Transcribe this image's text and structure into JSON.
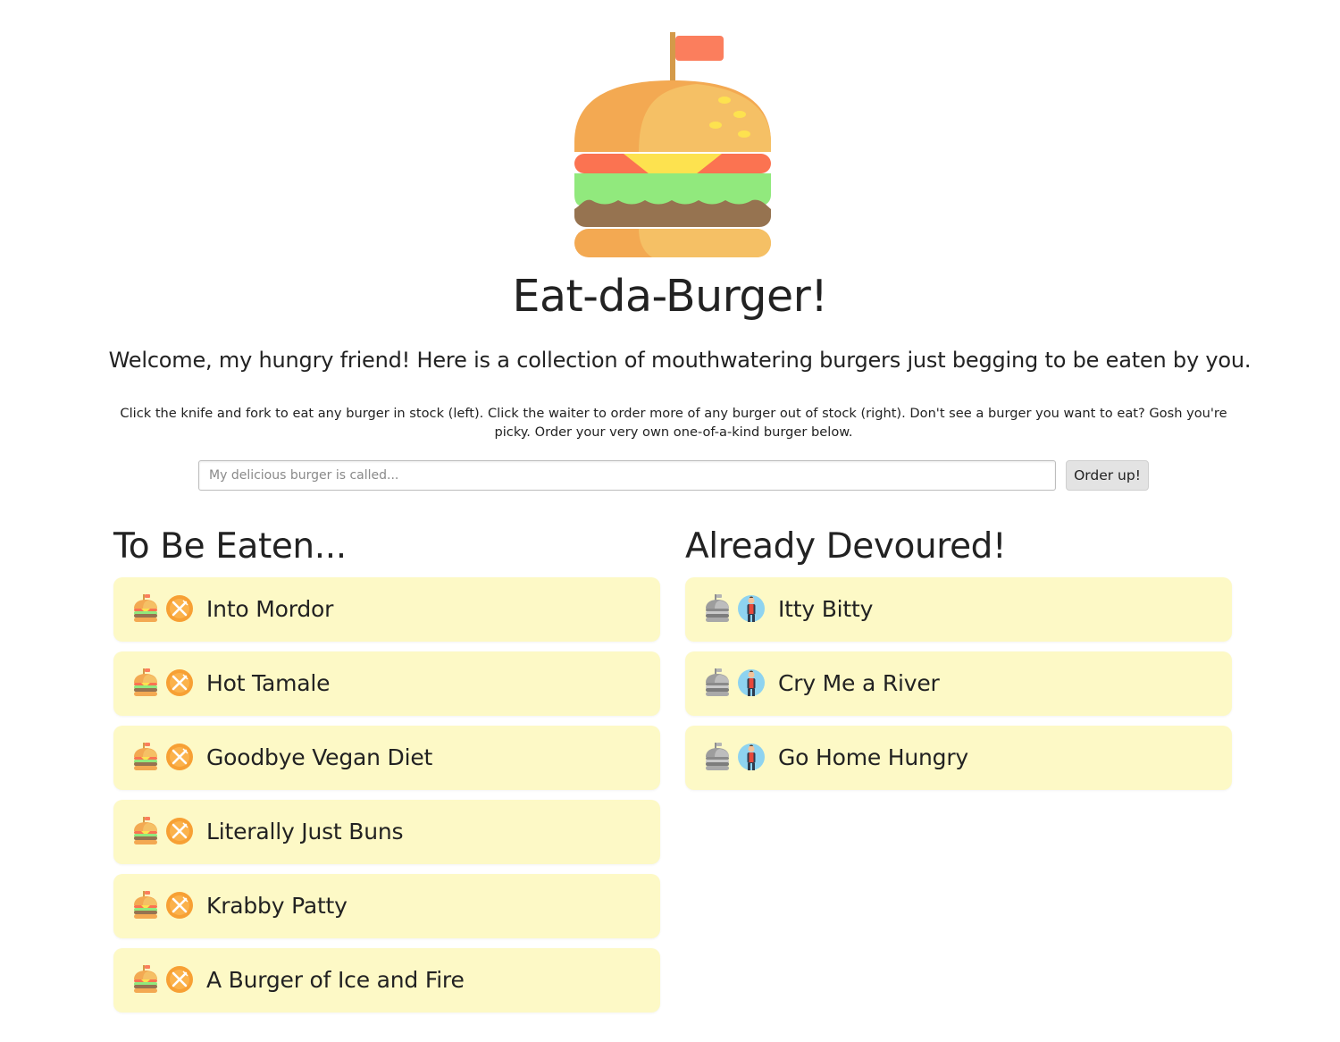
{
  "header": {
    "logo_icon": "burger-logo-icon",
    "title": "Eat-da-Burger!",
    "welcome": "Welcome, my hungry friend! Here is a collection of mouthwatering burgers just begging to be eaten by you.",
    "instructions": "Click the knife and fork to eat any burger in stock (left). Click the waiter to order more of any burger out of stock (right). Don't see a burger you want to eat? Gosh you're picky. Order your very own one-of-a-kind burger below."
  },
  "order_form": {
    "input_value": "",
    "placeholder": "My delicious burger is called...",
    "button_label": "Order up!"
  },
  "to_be_eaten": {
    "heading": "To Be Eaten...",
    "item_icon": "burger-icon",
    "action_icon": "knife-and-fork-icon",
    "items": [
      "Into Mordor",
      "Hot Tamale",
      "Goodbye Vegan Diet",
      "Literally Just Buns",
      "Krabby Patty",
      "A Burger of Ice and Fire"
    ]
  },
  "devoured": {
    "heading": "Already Devoured!",
    "item_icon": "cloche-icon",
    "action_icon": "waiter-icon",
    "items": [
      "Itty Bitty",
      "Cry Me a River",
      "Go Home Hungry"
    ]
  },
  "colors": {
    "item_background": "#fdf9c6",
    "bun": "#f3a952",
    "bun_light": "#f5c065",
    "tomato": "#fb7351",
    "cheese": "#fde24f",
    "lettuce": "#91e97d",
    "patty": "#967350",
    "flag": "#fb7e5d",
    "action_orange": "#f7a034",
    "waiter_circle": "#8ed3f0",
    "cloche": "#a9a9a9"
  }
}
